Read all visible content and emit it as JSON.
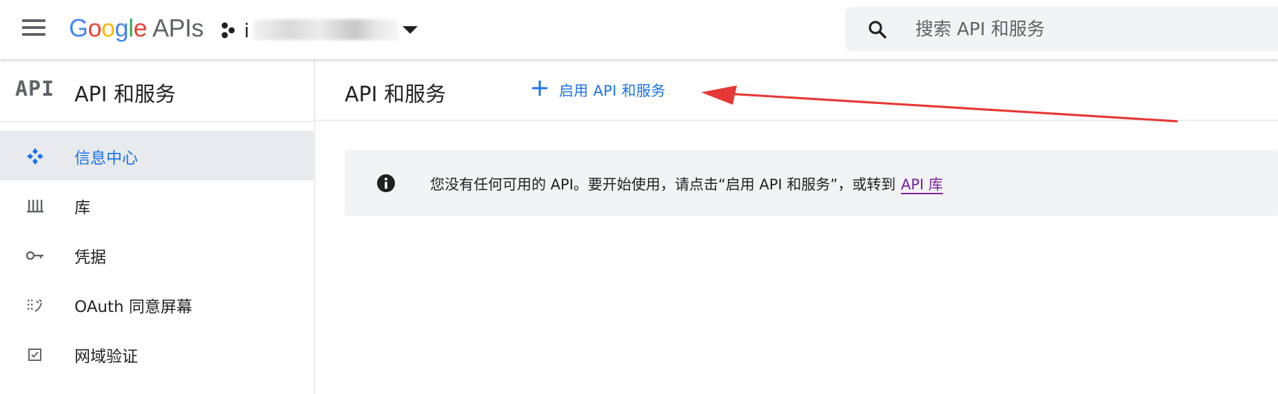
{
  "topbar": {
    "logo_google_letters": [
      "G",
      "o",
      "o",
      "g",
      "l",
      "e"
    ],
    "logo_suffix": "APIs",
    "project_initial": "i",
    "search_placeholder": "搜索 API 和服务"
  },
  "sidebar": {
    "logo_text": "API",
    "title": "API 和服务",
    "items": [
      {
        "label": "信息中心",
        "icon": "dashboard-icon",
        "active": true
      },
      {
        "label": "库",
        "icon": "library-icon",
        "active": false
      },
      {
        "label": "凭据",
        "icon": "key-icon",
        "active": false
      },
      {
        "label": "OAuth 同意屏幕",
        "icon": "consent-icon",
        "active": false
      },
      {
        "label": "网域验证",
        "icon": "checkbox-icon",
        "active": false
      }
    ]
  },
  "main": {
    "title": "API 和服务",
    "enable_button_label": "启用 API 和服务",
    "info_message": "您没有任何可用的 API。要开始使用，请点击“启用 API 和服务”，或转到",
    "info_link": "API 库"
  },
  "colors": {
    "accent": "#1a73e8",
    "active_nav_bg": "#e8eaed",
    "annotation_arrow": "#e53935",
    "link_visited": "#7b1fa2"
  }
}
